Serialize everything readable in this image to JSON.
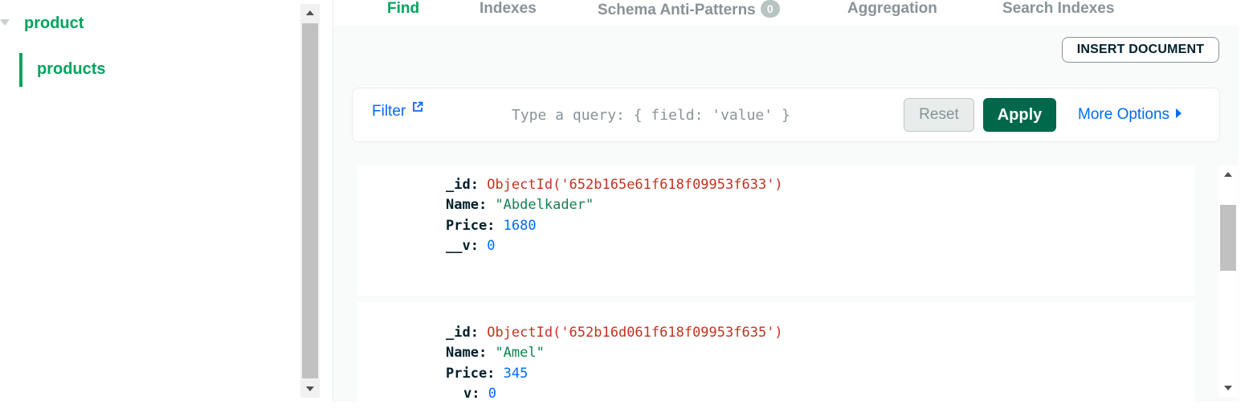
{
  "sidebar": {
    "database": "product",
    "collections": [
      {
        "label": "products",
        "active": true
      }
    ]
  },
  "tabs": [
    {
      "label": "Find",
      "active": true
    },
    {
      "label": "Indexes"
    },
    {
      "label": "Schema Anti-Patterns",
      "badge": "0"
    },
    {
      "label": "Aggregation"
    },
    {
      "label": "Search Indexes"
    }
  ],
  "toolbar": {
    "insert_label": "INSERT DOCUMENT"
  },
  "filter": {
    "label": "Filter",
    "placeholder": "Type a query: { field: 'value' }",
    "reset_label": "Reset",
    "apply_label": "Apply",
    "more_options_label": "More Options"
  },
  "documents": [
    {
      "id_key": "_id:",
      "id_value": "ObjectId('652b165e61f618f09953f633')",
      "name_key": "Name:",
      "name_value": "\"Abdelkader\"",
      "price_key": "Price:",
      "price_value": "1680",
      "v_key": "__v:",
      "v_value": "0"
    },
    {
      "id_key": "_id:",
      "id_value": "ObjectId('652b16d061f618f09953f635')",
      "name_key": "Name:",
      "name_value": "\"Amel\"",
      "price_key": "Price:",
      "price_value": "345",
      "v_key": "v:",
      "v_value": "0"
    }
  ],
  "colors": {
    "brand_green": "#00a35c",
    "apply_green": "#00684a",
    "link_blue": "#016bf8",
    "objectid_red": "#c2331f"
  }
}
